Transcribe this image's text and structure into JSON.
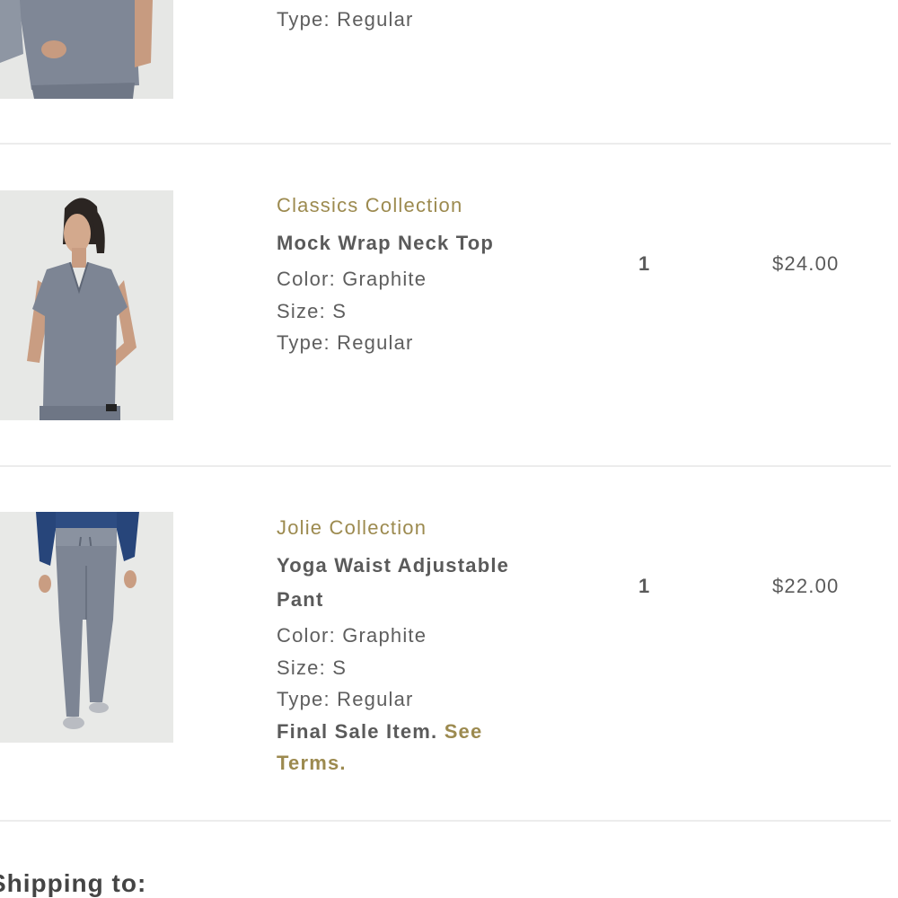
{
  "items": [
    {
      "type_label": "Type: Regular"
    },
    {
      "collection": "Classics Collection",
      "name": "Mock Wrap Neck Top",
      "color": "Color: Graphite",
      "size": "Size: S",
      "type": "Type: Regular",
      "quantity": "1",
      "price": "$24.00",
      "image_icon": "scrub-top-photo"
    },
    {
      "collection": "Jolie Collection",
      "name": "Yoga Waist Adjustable Pant",
      "color": "Color: Graphite",
      "size": "Size: S",
      "type": "Type: Regular",
      "final_sale": "Final Sale Item.",
      "see_terms": "See Terms.",
      "quantity": "1",
      "price": "$22.00",
      "image_icon": "scrub-pant-photo"
    }
  ],
  "shipping_heading": "Shipping to:",
  "colors": {
    "accent_gold": "#9c8a4f",
    "text_gray": "#5a5a5a",
    "scrub_graphite": "#7d8594"
  }
}
